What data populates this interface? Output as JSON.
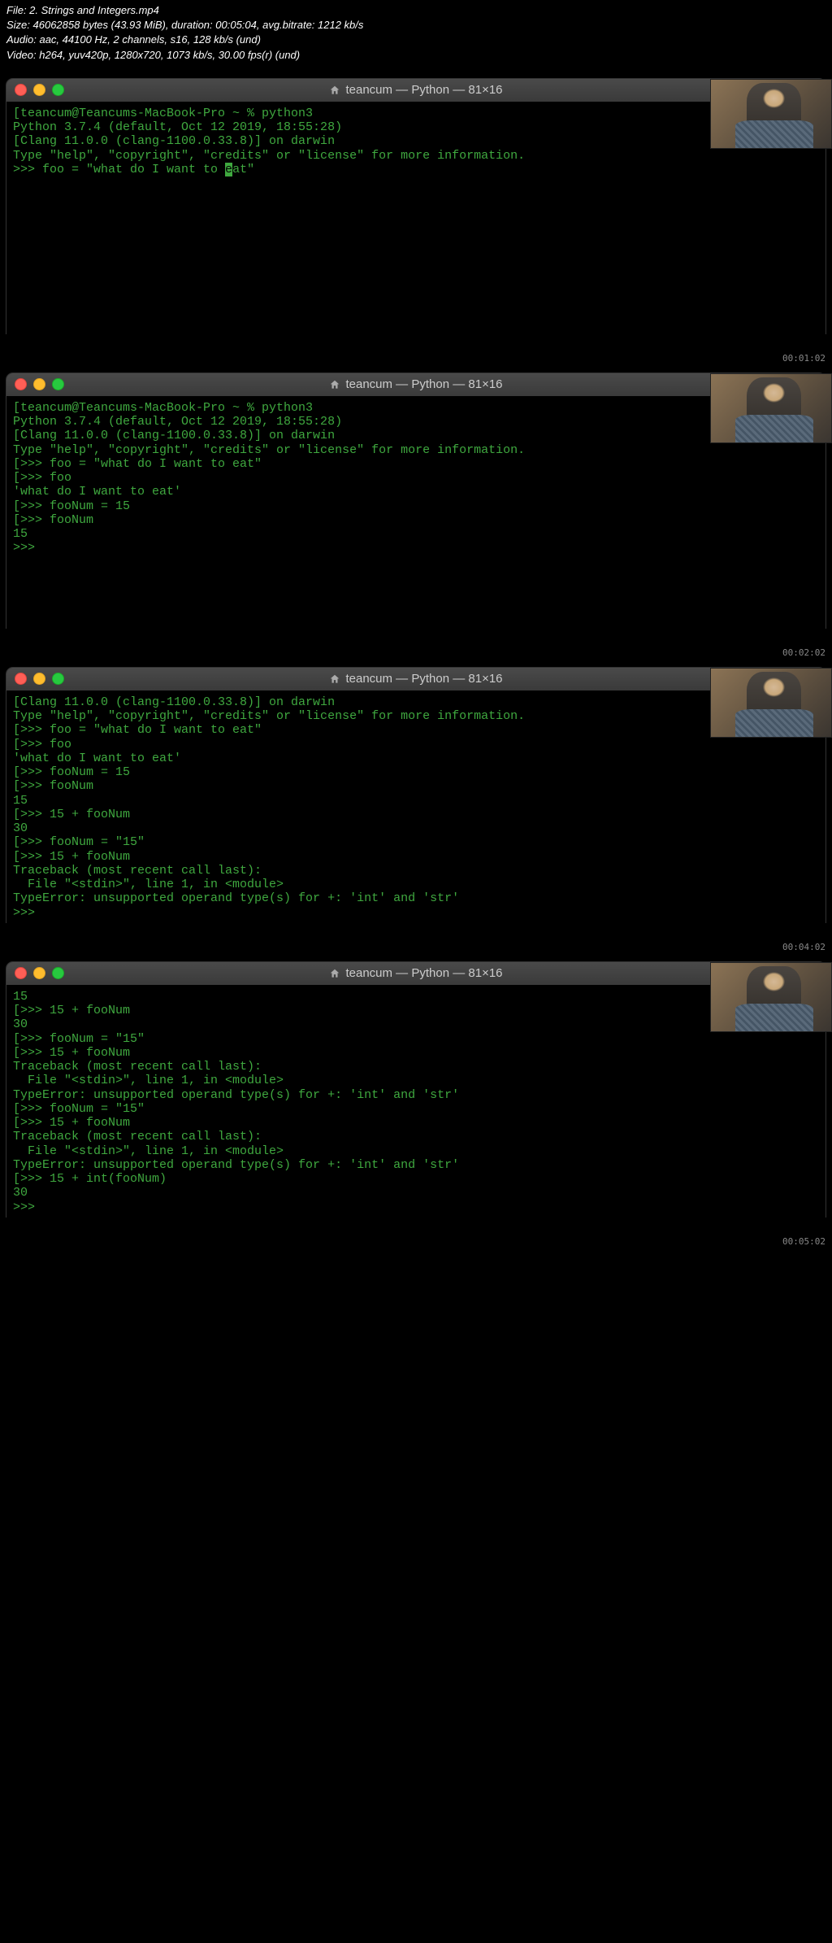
{
  "file_info": {
    "line1": "File: 2. Strings and Integers.mp4",
    "line2": "Size: 46062858 bytes (43.93 MiB), duration: 00:05:04, avg.bitrate: 1212 kb/s",
    "line3": "Audio: aac, 44100 Hz, 2 channels, s16, 128 kb/s (und)",
    "line4": "Video: h264, yuv420p, 1280x720, 1073 kb/s, 30.00 fps(r) (und)"
  },
  "window_title": "teancum — Python — 81×16",
  "frames": [
    {
      "timestamp": "00:01:02",
      "lines": [
        "[teancum@Teancums-MacBook-Pro ~ % python3",
        "Python 3.7.4 (default, Oct 12 2019, 18:55:28)",
        "[Clang 11.0.0 (clang-1100.0.33.8)] on darwin",
        "Type \"help\", \"copyright\", \"credits\" or \"license\" for more information.",
        ">>> foo = \"what do I want to ▮at\""
      ],
      "cursor_in_line": 4
    },
    {
      "timestamp": "00:02:02",
      "lines": [
        "[teancum@Teancums-MacBook-Pro ~ % python3",
        "Python 3.7.4 (default, Oct 12 2019, 18:55:28)",
        "[Clang 11.0.0 (clang-1100.0.33.8)] on darwin",
        "Type \"help\", \"copyright\", \"credits\" or \"license\" for more information.",
        "[>>> foo = \"what do I want to eat\"",
        "[>>> foo",
        "'what do I want to eat'",
        "[>>> fooNum = 15",
        "[>>> fooNum",
        "15",
        ">>> "
      ]
    },
    {
      "timestamp": "00:04:02",
      "lines": [
        "[Clang 11.0.0 (clang-1100.0.33.8)] on darwin",
        "Type \"help\", \"copyright\", \"credits\" or \"license\" for more information.",
        "[>>> foo = \"what do I want to eat\"",
        "[>>> foo",
        "'what do I want to eat'",
        "[>>> fooNum = 15",
        "[>>> fooNum",
        "15",
        "[>>> 15 + fooNum",
        "30",
        "[>>> fooNum = \"15\"",
        "[>>> 15 + fooNum",
        "Traceback (most recent call last):",
        "  File \"<stdin>\", line 1, in <module>",
        "TypeError: unsupported operand type(s) for +: 'int' and 'str'",
        ">>> "
      ]
    },
    {
      "timestamp": "00:05:02",
      "lines": [
        "15",
        "[>>> 15 + fooNum",
        "30",
        "[>>> fooNum = \"15\"",
        "[>>> 15 + fooNum",
        "Traceback (most recent call last):",
        "  File \"<stdin>\", line 1, in <module>",
        "TypeError: unsupported operand type(s) for +: 'int' and 'str'",
        "[>>> fooNum = \"15\"",
        "[>>> 15 + fooNum",
        "Traceback (most recent call last):",
        "  File \"<stdin>\", line 1, in <module>",
        "TypeError: unsupported operand type(s) for +: 'int' and 'str'",
        "[>>> 15 + int(fooNum)",
        "30",
        ">>> "
      ]
    }
  ]
}
